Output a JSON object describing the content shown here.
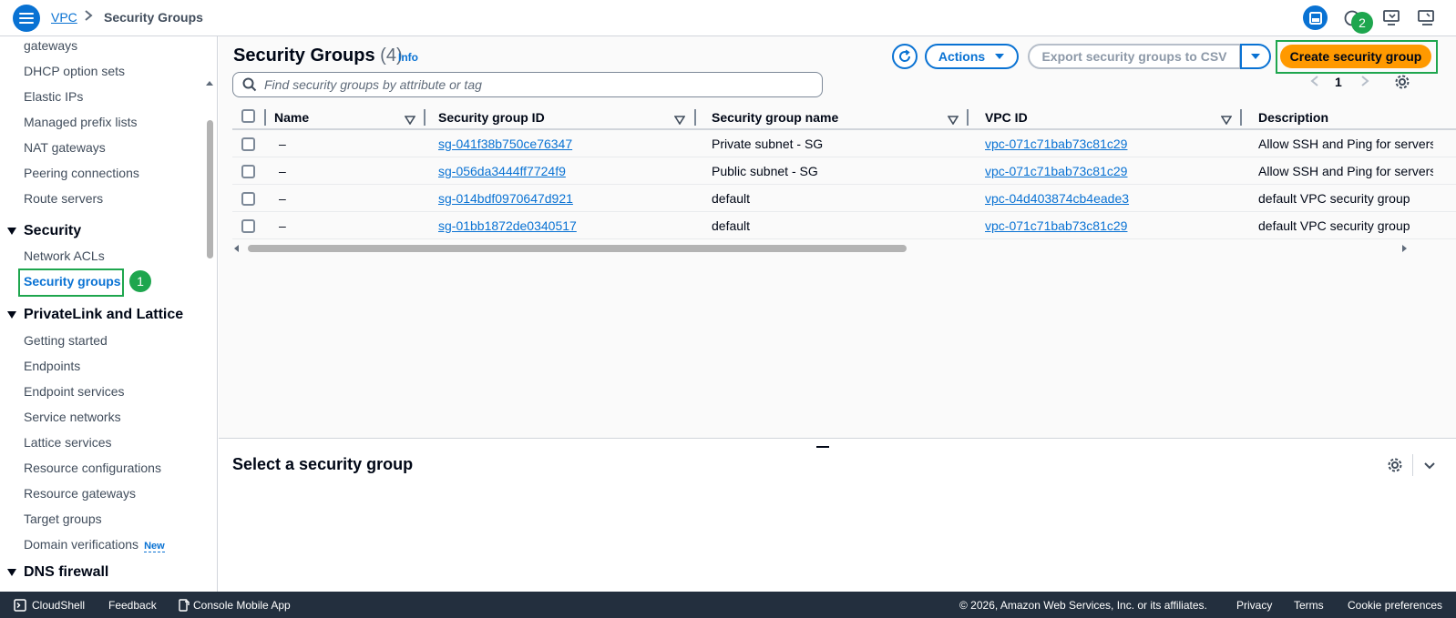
{
  "header": {
    "breadcrumb_root": "VPC",
    "breadcrumb_sep": ">",
    "breadcrumb_current": "Security Groups",
    "step2_badge": "2"
  },
  "sidebar": {
    "items": [
      {
        "label": "gateways"
      },
      {
        "label": "DHCP option sets"
      },
      {
        "label": "Elastic IPs"
      },
      {
        "label": "Managed prefix lists"
      },
      {
        "label": "NAT gateways"
      },
      {
        "label": "Peering connections"
      },
      {
        "label": "Route servers"
      }
    ],
    "security_section": "Security",
    "security_items": [
      {
        "label": "Network ACLs"
      },
      {
        "label": "Security groups"
      }
    ],
    "step1_badge": "1",
    "privatelink_section": "PrivateLink and Lattice",
    "privatelink_items": [
      {
        "label": "Getting started"
      },
      {
        "label": "Endpoints"
      },
      {
        "label": "Endpoint services"
      },
      {
        "label": "Service networks"
      },
      {
        "label": "Lattice services"
      },
      {
        "label": "Resource configurations"
      },
      {
        "label": "Resource gateways"
      },
      {
        "label": "Target groups"
      },
      {
        "label": "Domain verifications"
      }
    ],
    "new_tag": "New",
    "dns_section": "DNS firewall"
  },
  "main": {
    "title": "Security Groups",
    "count": "(4)",
    "info": "Info",
    "actions_label": "Actions",
    "export_label": "Export security groups to CSV",
    "create_label": "Create security group",
    "search_placeholder": "Find security groups by attribute or tag",
    "page_number": "1",
    "columns": [
      "Name",
      "Security group ID",
      "Security group name",
      "VPC ID",
      "Description"
    ],
    "rows": [
      {
        "name": "–",
        "sg_id": "sg-041f38b750ce76347",
        "sg_name": "Private subnet - SG",
        "vpc_id": "vpc-071c71bab73c81c29",
        "description": "Allow SSH and Ping for servers"
      },
      {
        "name": "–",
        "sg_id": "sg-056da3444ff7724f9",
        "sg_name": "Public subnet - SG",
        "vpc_id": "vpc-071c71bab73c81c29",
        "description": "Allow SSH and Ping for servers"
      },
      {
        "name": "–",
        "sg_id": "sg-014bdf0970647d921",
        "sg_name": "default",
        "vpc_id": "vpc-04d403874cb4eade3",
        "description": "default VPC security group"
      },
      {
        "name": "–",
        "sg_id": "sg-01bb1872de0340517",
        "sg_name": "default",
        "vpc_id": "vpc-071c71bab73c81c29",
        "description": "default VPC security group"
      }
    ],
    "detail_title": "Select a security group"
  },
  "footer": {
    "cloudshell": "CloudShell",
    "feedback": "Feedback",
    "mobile_app": "Console Mobile App",
    "copyright": "© 2026, Amazon Web Services, Inc. or its affiliates.",
    "privacy": "Privacy",
    "terms": "Terms",
    "cookies": "Cookie preferences"
  },
  "colors": {
    "accent": "#0972d3",
    "primary_button": "#ff9900",
    "highlight": "#1ea64e",
    "footer_bg": "#232f3e"
  }
}
